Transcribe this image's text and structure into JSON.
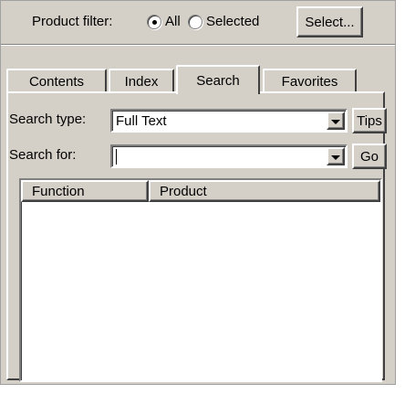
{
  "filter": {
    "label": "Product filter:",
    "option_all": "All",
    "option_selected": "Selected",
    "selected_option": "All",
    "select_button": "Select..."
  },
  "tabs": [
    {
      "label": "Contents",
      "active": false
    },
    {
      "label": "Index",
      "active": false
    },
    {
      "label": "Search",
      "active": true
    },
    {
      "label": "Favorites",
      "active": false
    }
  ],
  "search": {
    "type_label": "Search type:",
    "type_value": "Full Text",
    "tips_button": "Tips",
    "for_label": "Search for:",
    "for_value": "",
    "go_button": "Go"
  },
  "results": {
    "columns": [
      "Function",
      "Product"
    ],
    "rows": []
  }
}
